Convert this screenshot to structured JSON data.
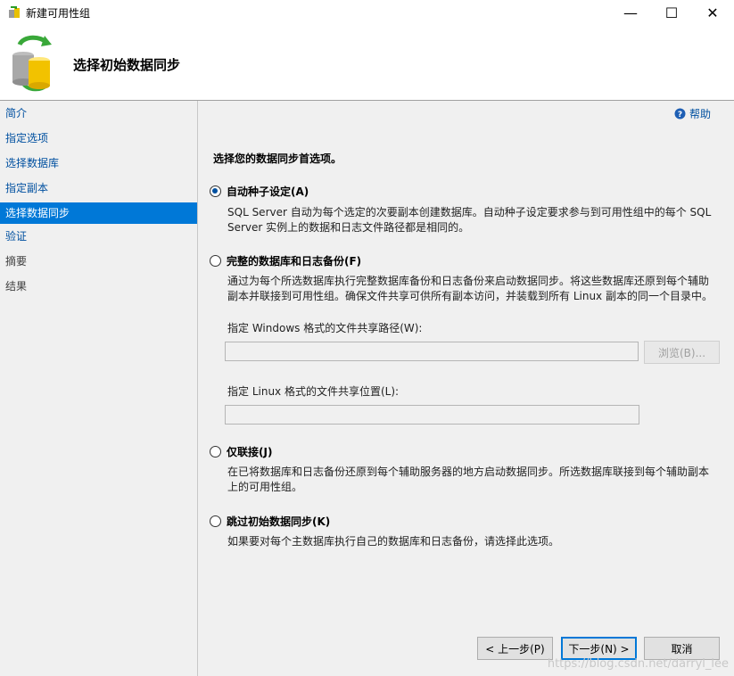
{
  "window": {
    "title": "新建可用性组",
    "minimize": "—",
    "maximize": "☐",
    "close": "✕"
  },
  "header": {
    "title": "选择初始数据同步"
  },
  "nav": {
    "items": [
      {
        "label": "简介",
        "state": "link"
      },
      {
        "label": "指定选项",
        "state": "link"
      },
      {
        "label": "选择数据库",
        "state": "link"
      },
      {
        "label": "指定副本",
        "state": "link"
      },
      {
        "label": "选择数据同步",
        "state": "active"
      },
      {
        "label": "验证",
        "state": "link"
      },
      {
        "label": "摘要",
        "state": "disabled"
      },
      {
        "label": "结果",
        "state": "disabled"
      }
    ]
  },
  "help": {
    "label": "帮助"
  },
  "main": {
    "intro": "选择您的数据同步首选项。",
    "options": [
      {
        "label": "自动种子设定(A)",
        "selected": true,
        "desc": "SQL Server 自动为每个选定的次要副本创建数据库。自动种子设定要求参与到可用性组中的每个 SQL Server 实例上的数据和日志文件路径都是相同的。"
      },
      {
        "label": "完整的数据库和日志备份(F)",
        "selected": false,
        "desc": "通过为每个所选数据库执行完整数据库备份和日志备份来启动数据同步。将这些数据库还原到每个辅助副本并联接到可用性组。确保文件共享可供所有副本访问，并装载到所有 Linux 副本的同一个目录中。"
      },
      {
        "label": "仅联接(J)",
        "selected": false,
        "desc": "在已将数据库和日志备份还原到每个辅助服务器的地方启动数据同步。所选数据库联接到每个辅助副本上的可用性组。"
      },
      {
        "label": "跳过初始数据同步(K)",
        "selected": false,
        "desc": "如果要对每个主数据库执行自己的数据库和日志备份，请选择此选项。"
      }
    ],
    "windows_share_label": "指定 Windows 格式的文件共享路径(W):",
    "windows_share_value": "",
    "browse_label": "浏览(B)...",
    "linux_share_label": "指定 Linux 格式的文件共享位置(L):",
    "linux_share_value": ""
  },
  "footer": {
    "prev": "< 上一步(P)",
    "next": "下一步(N) >",
    "cancel": "取消"
  },
  "watermark": "https://blog.csdn.net/darryl_lee",
  "colors": {
    "accent": "#0078d7",
    "link": "#0050a0",
    "panel": "#f0f0f0"
  }
}
